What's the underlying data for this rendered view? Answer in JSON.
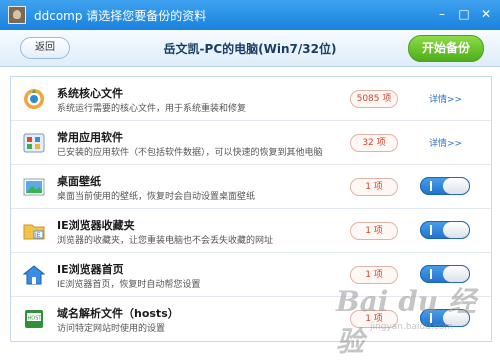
{
  "titlebar": {
    "title": "ddcomp 请选择您要备份的资料",
    "icons": [
      "user-avatar-icon",
      "minimize-icon",
      "maximize-icon",
      "close-icon"
    ]
  },
  "toolbar": {
    "back_label": "返回",
    "pc_title": "岳文凯-PC的电脑(Win7/32位)",
    "start_label": "开始备份"
  },
  "items": [
    {
      "title": "系统核心文件",
      "desc": "系统运行需要的核心文件，用于系统重装和修复",
      "count": "5085 项",
      "detail": "详情>>",
      "icon": "system-core-icon"
    },
    {
      "title": "常用应用软件",
      "desc": "已安装的应用软件（不包括软件数据），可以快速的恢复到其他电脑",
      "count": "32 项",
      "detail": "详情>>",
      "icon": "apps-icon"
    },
    {
      "title": "桌面壁纸",
      "desc": "桌面当前使用的壁纸，恢复时会自动设置桌面壁纸",
      "count": "1 项",
      "toggle": "on",
      "icon": "wallpaper-icon"
    },
    {
      "title": "IE浏览器收藏夹",
      "desc": "浏览器的收藏夹，让您重装电脑也不会丢失收藏的网址",
      "count": "1 项",
      "toggle": "on",
      "icon": "ie-favorites-folder-icon"
    },
    {
      "title": "IE浏览器首页",
      "desc": "IE浏览器首页，恢复时自动帮您设置",
      "count": "1 项",
      "toggle": "on",
      "icon": "ie-homepage-icon"
    },
    {
      "title": "域名解析文件（hosts）",
      "desc": "访问特定网站时使用的设置",
      "count": "1 项",
      "toggle": "on",
      "icon": "hosts-file-icon"
    }
  ],
  "watermark": {
    "main": "Bai du 经验",
    "sub": "jingyan.baidu.com"
  }
}
